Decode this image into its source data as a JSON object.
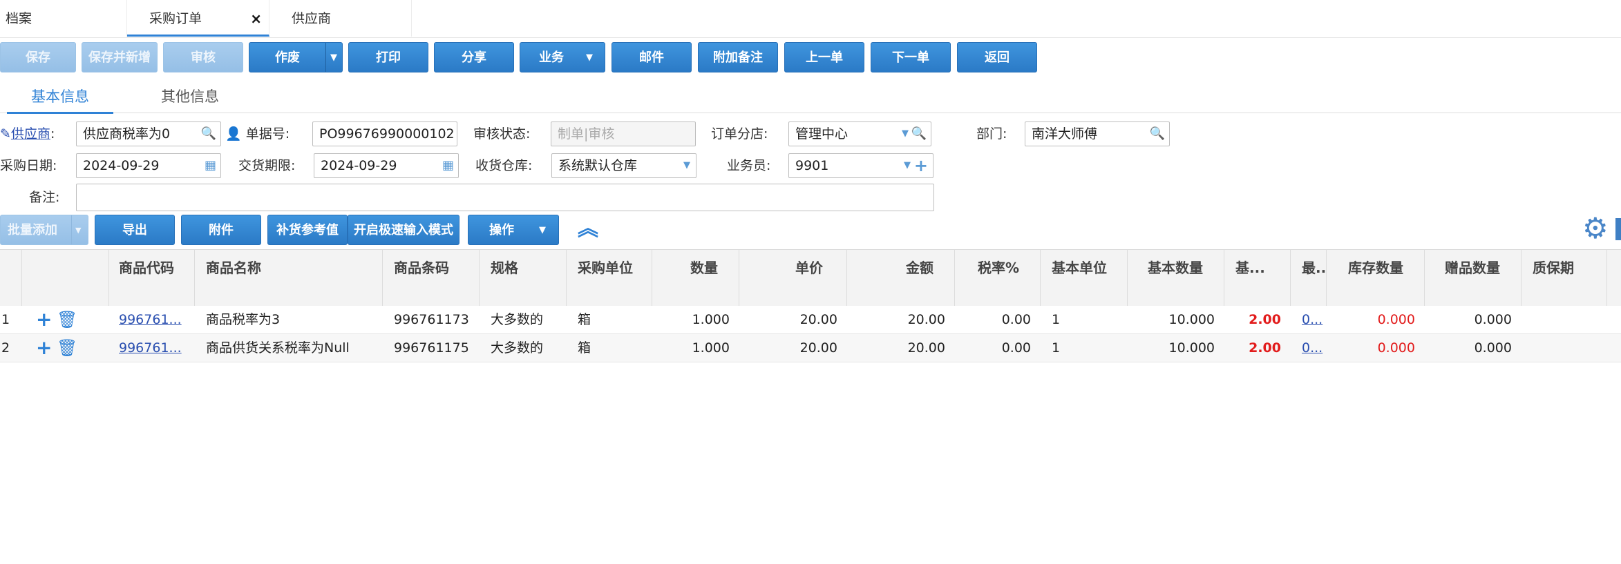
{
  "tabs": [
    {
      "label": "档案"
    },
    {
      "label": "采购订单",
      "close": "×"
    },
    {
      "label": "供应商"
    }
  ],
  "toolbar": {
    "save": "保存",
    "save_new": "保存并新增",
    "audit": "审核",
    "void": "作废",
    "print": "打印",
    "share": "分享",
    "business": "业务",
    "mail": "邮件",
    "remark": "附加备注",
    "prev": "上一单",
    "next": "下一单",
    "back": "返回"
  },
  "section_tabs": [
    "基本信息",
    "其他信息"
  ],
  "form": {
    "supplier_label": "供应商",
    "supplier_value": "供应商税率为0",
    "docno_label": "单据号:",
    "docno_value": "PO99676990000102",
    "audit_status_label": "审核状态:",
    "audit_status_value": "制单|审核",
    "branch_label": "订单分店:",
    "branch_value": "管理中心",
    "dept_label": "部门:",
    "dept_value": "南洋大师傅",
    "purchase_date_label": "采购日期:",
    "purchase_date_value": "2024-09-29",
    "delivery_label": "交货期限:",
    "delivery_value": "2024-09-29",
    "warehouse_label": "收货仓库:",
    "warehouse_value": "系统默认仓库",
    "clerk_label": "业务员:",
    "clerk_value": "9901",
    "note_label": "备注:",
    "note_value": ""
  },
  "grid_toolbar": {
    "batch_add": "批量添加",
    "export": "导出",
    "attach": "附件",
    "replenish": "补货参考值",
    "fast_mode": "开启极速输入模式",
    "ops": "操作"
  },
  "grid": {
    "columns": [
      "商品代码",
      "商品名称",
      "商品条码",
      "规格",
      "采购单位",
      "数量",
      "单价",
      "金额",
      "税率%",
      "基本单位",
      "基本数量",
      "基...",
      "最...",
      "库存数量",
      "赠品数量",
      "质保期"
    ],
    "rows": [
      {
        "no": "1",
        "code": "996761...",
        "name": "商品税率为3",
        "barcode": "996761173",
        "spec": "大多数的",
        "unit": "箱",
        "qty": "1.000",
        "price": "20.00",
        "amount": "20.00",
        "tax": "0.00",
        "base_unit": "1",
        "base_qty": "10.000",
        "base_price": "2.00",
        "last": "0...",
        "stock": "0.000",
        "gift": "0.000",
        "shelf": ""
      },
      {
        "no": "2",
        "code": "996761...",
        "name": "商品供货关系税率为Null",
        "barcode": "996761175",
        "spec": "大多数的",
        "unit": "箱",
        "qty": "1.000",
        "price": "20.00",
        "amount": "20.00",
        "tax": "0.00",
        "base_unit": "1",
        "base_qty": "10.000",
        "base_price": "2.00",
        "last": "0...",
        "stock": "0.000",
        "gift": "0.000",
        "shelf": ""
      }
    ]
  },
  "colors": {
    "accent": "#2f82d6",
    "danger": "#e21c1c"
  }
}
